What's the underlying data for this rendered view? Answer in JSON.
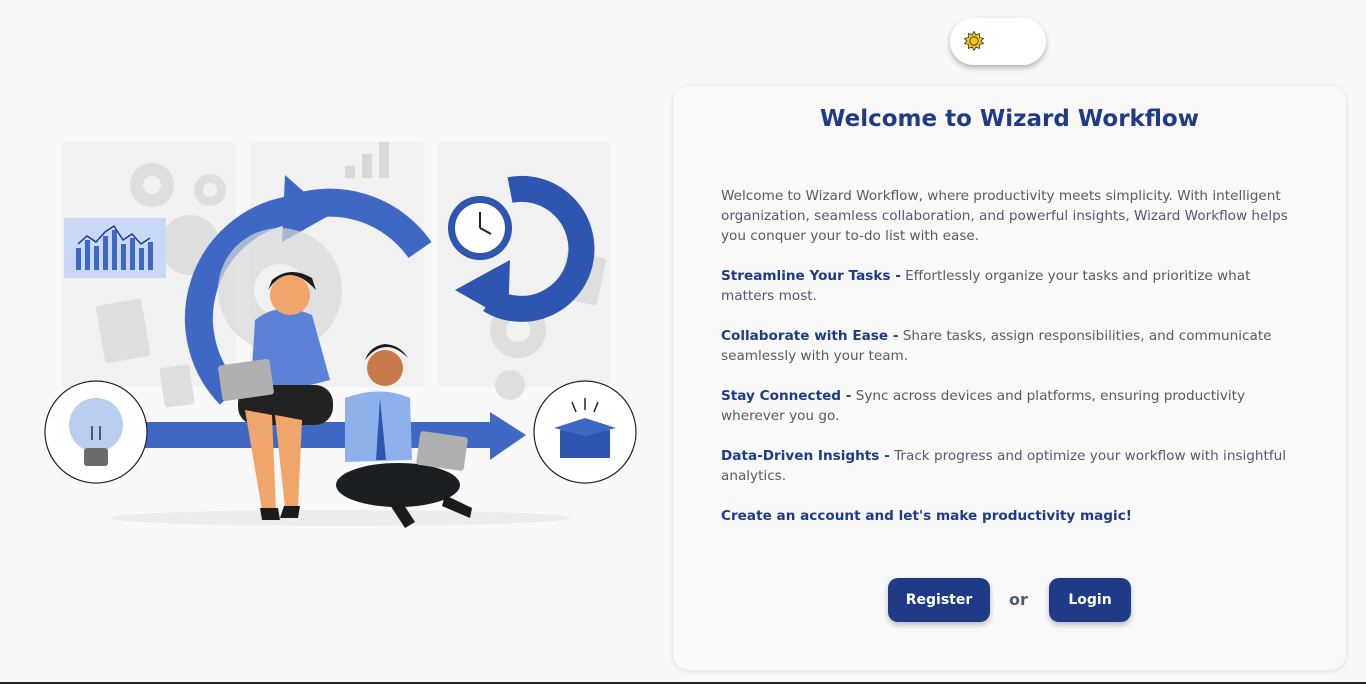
{
  "theme_toggle": {
    "icon": "sun-icon"
  },
  "card": {
    "title": "Welcome to Wizard Workflow",
    "intro": "Welcome to Wizard Workflow, where productivity meets simplicity. With intelligent organization, seamless collaboration, and powerful insights, Wizard Workflow helps you conquer your to-do list with ease.",
    "features": [
      {
        "heading": "Streamline Your Tasks -",
        "text": " Effortlessly organize your tasks and prioritize what matters most."
      },
      {
        "heading": "Collaborate with Ease -",
        "text": " Share tasks, assign responsibilities, and communicate seamlessly with your team."
      },
      {
        "heading": "Stay Connected -",
        "text": " Sync across devices and platforms, ensuring productivity wherever you go."
      },
      {
        "heading": "Data-Driven Insights -",
        "text": " Track progress and optimize your workflow with insightful analytics."
      }
    ],
    "cta": "Create an account and let's make productivity magic!",
    "register_label": "Register",
    "or_label": "or",
    "login_label": "Login"
  },
  "colors": {
    "brand": "#1f3a86",
    "accent_blue": "#3f68c4",
    "background": "#f8f8f8",
    "sun": "#f5c518"
  }
}
